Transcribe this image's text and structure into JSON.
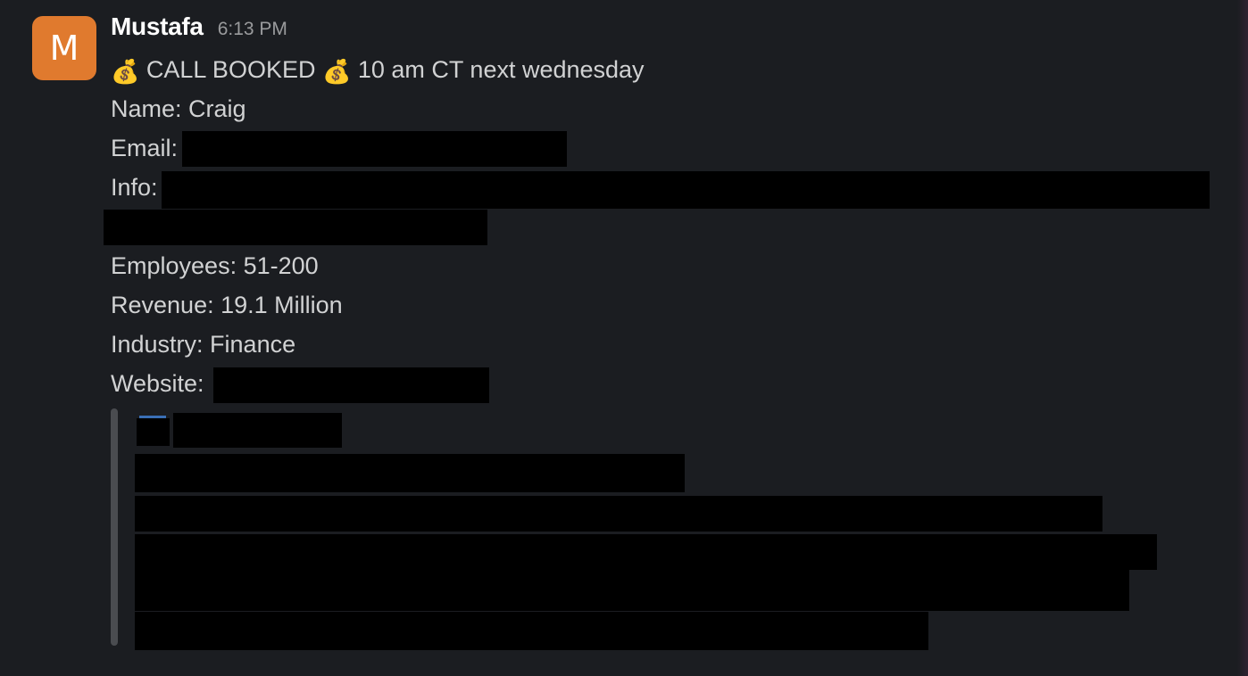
{
  "message": {
    "avatar_letter": "M",
    "avatar_color": "#e07a2e",
    "sender": "Mustafa",
    "timestamp": "6:13 PM",
    "headline": {
      "emoji": "💰",
      "text": "CALL BOOKED",
      "detail": "10 am CT next wednesday"
    },
    "fields": {
      "name": "Name: Craig",
      "email_label": "Email:",
      "info_label": "Info:",
      "employees": "Employees: 51-200",
      "revenue": "Revenue: 19.1 Million",
      "industry": "Industry: Finance",
      "website_label": "Website:"
    }
  },
  "redacted_color": "#000000",
  "link_preview": {
    "border_color": "#4a4c50"
  }
}
